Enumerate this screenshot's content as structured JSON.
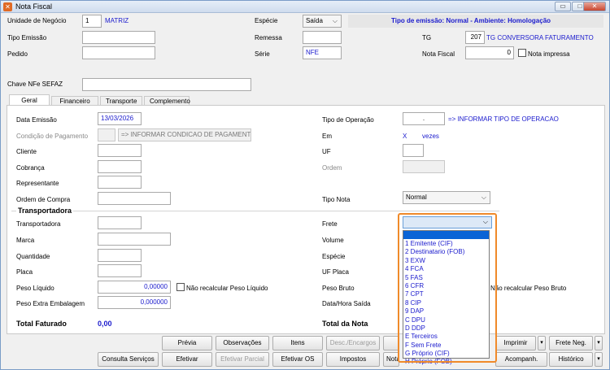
{
  "window": {
    "title": "Nota Fiscal",
    "min": "▭",
    "max": "□",
    "close": "✕"
  },
  "header": {
    "unidade_label": "Unidade de Negócio",
    "unidade_code": "1",
    "unidade_name": "MATRIZ",
    "especie_label": "Espécie",
    "especie_value": "Saída",
    "emissao_info": "Tipo de emissão: Normal - Ambiente: Homologação",
    "tipo_emissao_label": "Tipo Emissão",
    "remessa_label": "Remessa",
    "tg_label": "TG",
    "tg_code": "207",
    "tg_name": "TG CONVERSORA FATURAMENTO",
    "pedido_label": "Pedido",
    "serie_label": "Série",
    "serie_value": "NFE",
    "nota_fiscal_label": "Nota Fiscal",
    "nota_fiscal_value": "0",
    "nota_impressa_label": "Nota impressa",
    "chave_label": "Chave NFe SEFAZ"
  },
  "tabs": [
    "Geral",
    "Financeiro",
    "Transporte",
    "Complemento"
  ],
  "geral": {
    "data_emissao_label": "Data Emissão",
    "data_emissao_value": "13/03/2026",
    "tipo_operacao_label": "Tipo de Operação",
    "tipo_operacao_value": ".",
    "tipo_operacao_hint": "=> INFORMAR TIPO DE OPERACAO",
    "cond_pag_label": "Condição de Pagamento",
    "cond_pag_hint": "=> INFORMAR CONDICAO DE PAGAMENTO",
    "em_label": "Em",
    "em_x": "X",
    "em_vezes": "vezes",
    "cliente_label": "Cliente",
    "uf_label": "UF",
    "cobranca_label": "Cobrança",
    "ordem_label": "Ordem",
    "representante_label": "Representante",
    "ordem_compra_label": "Ordem de Compra",
    "tipo_nota_label": "Tipo Nota",
    "tipo_nota_value": "Normal"
  },
  "transportadora": {
    "group_label": "Transportadora",
    "transportadora_label": "Transportadora",
    "frete_label": "Frete",
    "marca_label": "Marca",
    "volume_label": "Volume",
    "quantidade_label": "Quantidade",
    "especie_label": "Espécie",
    "placa_label": "Placa",
    "uf_placa_label": "UF Placa",
    "peso_liquido_label": "Peso Líquido",
    "peso_liquido_value": "0,00000",
    "nao_recalc_liq": "Não recalcular Peso Líquido",
    "peso_bruto_label": "Peso Bruto",
    "nao_recalc_bruto": "Não recalcular Peso Bruto",
    "peso_extra_label": "Peso Extra Embalagem",
    "peso_extra_value": "0,000000",
    "data_hora_saida_label": "Data/Hora Saída"
  },
  "totais": {
    "total_faturado_label": "Total Faturado",
    "total_faturado_value": "0,00",
    "total_nota_label": "Total da Nota"
  },
  "frete_options": [
    "1 Emitente (CIF)",
    "2 Destinatario (FOB)",
    "3 EXW",
    "4 FCA",
    "5 FAS",
    "6 CFR",
    "7 CPT",
    "8 CIP",
    "9 DAP",
    "C DPU",
    "D DDP",
    "E Terceiros",
    "F Sem Frete",
    "G Próprio (CIF)",
    "H Próprio (FOB)"
  ],
  "buttons": {
    "previa": "Prévia",
    "observacoes": "Observações",
    "itens": "Itens",
    "desc_encargos": "Desc./Encargos",
    "imprimir": "Imprimir",
    "frete_neg": "Frete Neg.",
    "consulta_servicos": "Consulta Serviços",
    "efetivar": "Efetivar",
    "efetivar_parcial": "Efetivar Parcial",
    "efetivar_os": "Efetivar OS",
    "impostos": "Impostos",
    "nota_ref": "Nota",
    "acompanh": "Acompanh.",
    "historico": "Histórico"
  }
}
